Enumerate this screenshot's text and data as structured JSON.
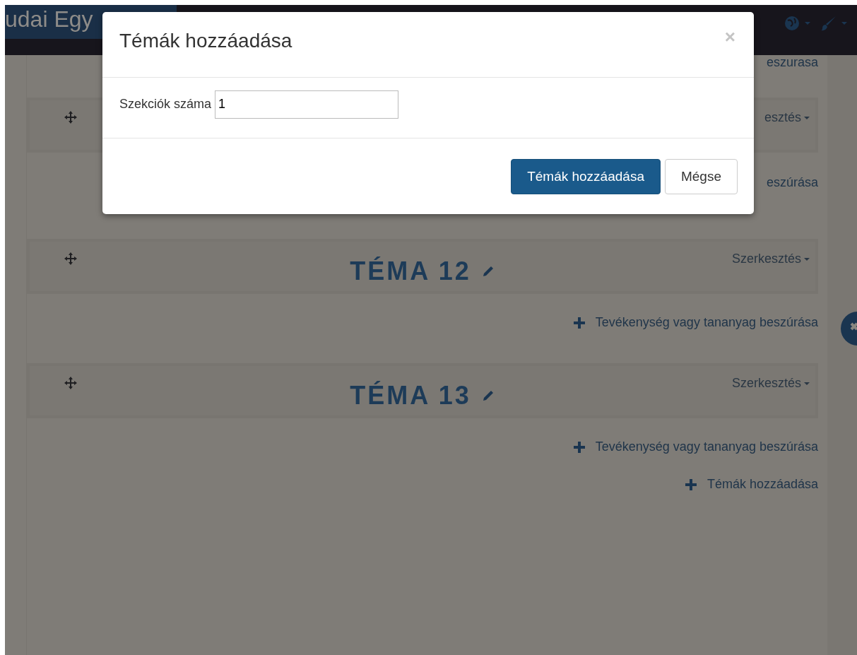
{
  "topbar": {
    "brand": "udai Egy",
    "icons": [
      {
        "kind": "globe"
      },
      {
        "kind": "brush"
      }
    ]
  },
  "rows": [
    {
      "kind": "body",
      "links": [
        {
          "text": "eszurasa",
          "plus": false
        }
      ]
    },
    {
      "kind": "header",
      "edit_menu": "esztés"
    },
    {
      "kind": "body",
      "links": [
        {
          "text": "eszúrása",
          "plus": false
        }
      ]
    },
    {
      "kind": "header",
      "title": "TÉMA 12",
      "edit_menu": "Szerkesztés"
    },
    {
      "kind": "body",
      "links": [
        {
          "text": "Tevékenység vagy tananyag beszúrása",
          "plus": true
        }
      ]
    },
    {
      "kind": "header",
      "title": "TÉMA 13",
      "edit_menu": "Szerkesztés"
    },
    {
      "kind": "body",
      "links": [
        {
          "text": "Tevékenység vagy tananyag beszúrása",
          "plus": true
        },
        {
          "text": "Témák hozzáadása",
          "plus": true
        }
      ]
    }
  ],
  "modal": {
    "title": "Témák hozzáadása",
    "close": "×",
    "field": {
      "label": "Szekciók száma",
      "value": "1"
    },
    "buttons": [
      {
        "label": "Témák hozzáadása",
        "primary": true
      },
      {
        "label": "Mégse",
        "primary": false
      }
    ]
  }
}
